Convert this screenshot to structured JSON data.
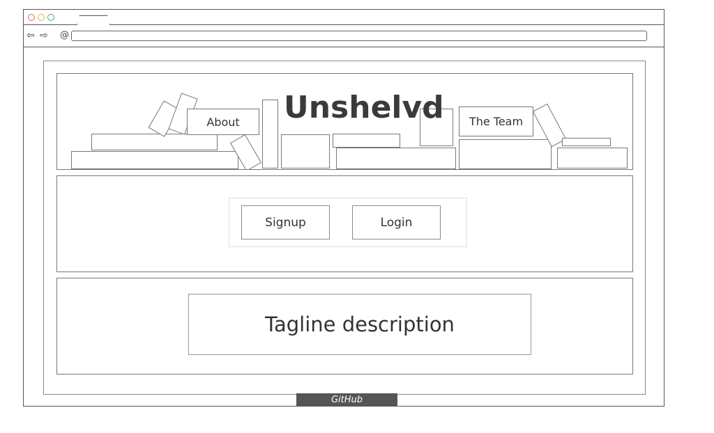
{
  "browser": {
    "dot_colors": [
      "#e06060",
      "#e0b040",
      "#50b050"
    ],
    "back_icon": "back-arrow-icon",
    "forward_icon": "forward-arrow-icon",
    "url_icon": "at-icon",
    "url_value": ""
  },
  "header": {
    "title": "Unshelvd",
    "about_label": "About",
    "team_label": "The Team"
  },
  "auth": {
    "signup_label": "Signup",
    "login_label": "Login"
  },
  "tagline": {
    "text": "Tagline description"
  },
  "footer": {
    "github_label": "GitHub"
  }
}
